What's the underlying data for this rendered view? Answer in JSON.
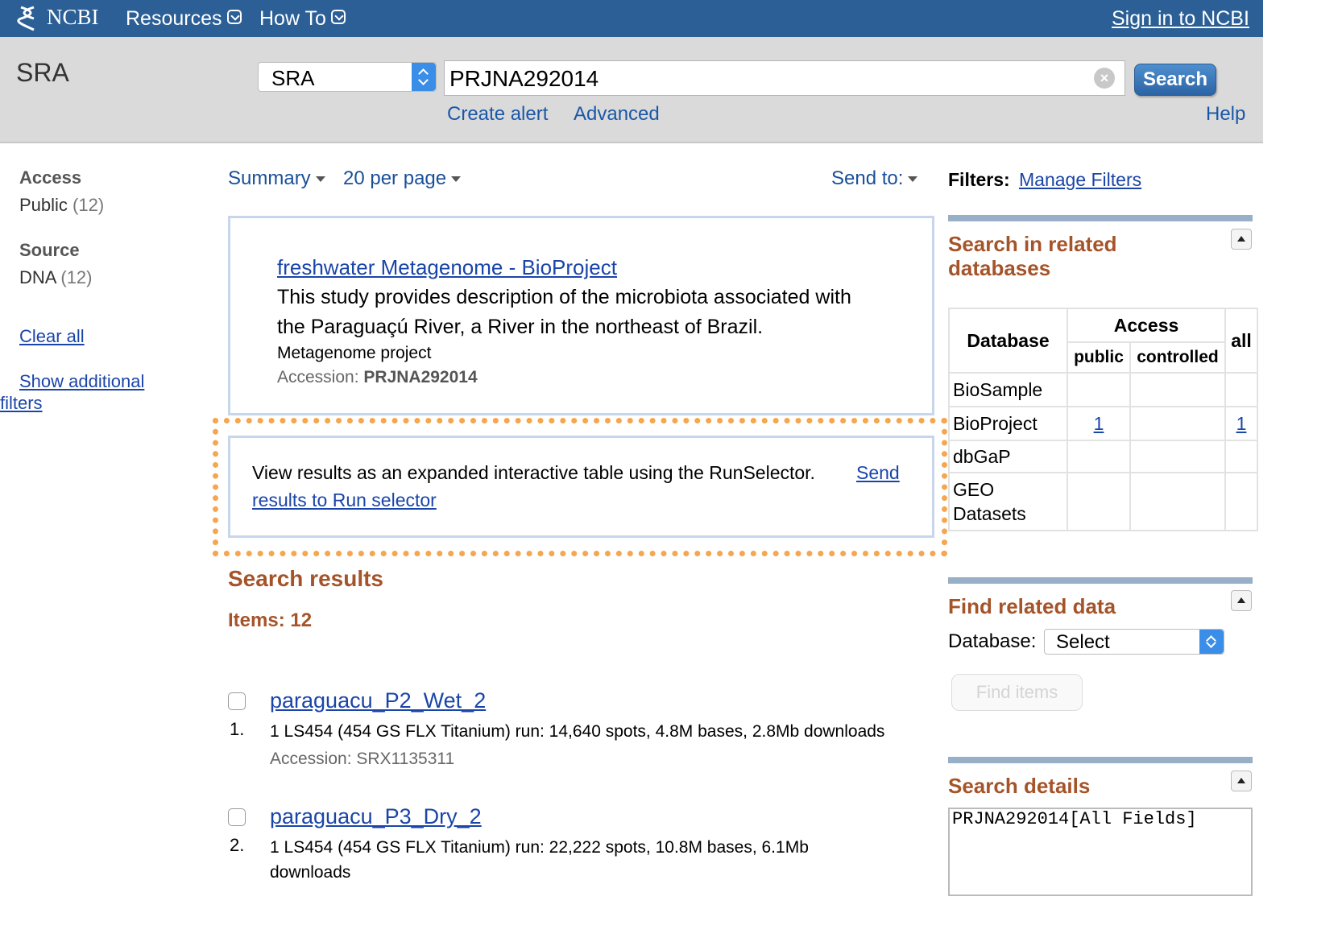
{
  "topbar": {
    "logo": "NCBI",
    "resources": "Resources",
    "how_to": "How To",
    "sign_in": "Sign in to NCBI"
  },
  "search": {
    "db_label": "SRA",
    "db_selected": "SRA",
    "term": "PRJNA292014",
    "search_button": "Search",
    "create_alert": "Create alert",
    "advanced": "Advanced",
    "help": "Help"
  },
  "filters": {
    "groups": [
      {
        "heading": "Access",
        "item": "Public",
        "count": "(12)"
      },
      {
        "heading": "Source",
        "item": "DNA",
        "count": "(12)"
      }
    ],
    "clear_all": "Clear all",
    "show_additional_1": "Show additional",
    "show_additional_2": "filters"
  },
  "display": {
    "format": "Summary",
    "per_page": "20 per page",
    "send_to": "Send to:"
  },
  "bioproject": {
    "title": "freshwater Metagenome - BioProject",
    "description_line1": "This study provides description of the microbiota associated with",
    "description_line2": "the Paraguaçú River, a River in the northeast of Brazil.",
    "project_type": "Metagenome project",
    "accession_label": "Accession:",
    "accession_value": "PRJNA292014"
  },
  "runselector": {
    "text": "View results as an expanded interactive table using the RunSelector.",
    "link_part1": "Send",
    "link_part2": "results to Run selector"
  },
  "results": {
    "heading": "Search results",
    "items_count": "Items: 12",
    "list": [
      {
        "num": "1.",
        "title": "paraguacu_P2_Wet_2",
        "desc": "1 LS454 (454 GS FLX Titanium) run: 14,640 spots, 4.8M bases, 2.8Mb downloads",
        "accession": "Accession: SRX1135311"
      },
      {
        "num": "2.",
        "title": "paraguacu_P3_Dry_2",
        "desc_line1": "1 LS454 (454 GS FLX Titanium) run: 22,222 spots, 10.8M bases, 6.1Mb",
        "desc_line2": "downloads"
      }
    ]
  },
  "right": {
    "filters_label": "Filters:",
    "manage_filters": "Manage Filters",
    "related_db_heading_1": "Search in related",
    "related_db_heading_2": "databases",
    "table": {
      "col_database": "Database",
      "col_access": "Access",
      "col_public": "public",
      "col_controlled": "controlled",
      "col_all": "all",
      "rows": [
        {
          "db": "BioSample",
          "public": "",
          "controlled": "",
          "all": ""
        },
        {
          "db": "BioProject",
          "public": "1",
          "controlled": "",
          "all": "1"
        },
        {
          "db": "dbGaP",
          "public": "",
          "controlled": "",
          "all": ""
        },
        {
          "db_line1": "GEO",
          "db_line2": "Datasets",
          "public": "",
          "controlled": "",
          "all": ""
        }
      ]
    },
    "find_related_heading": "Find related data",
    "database_label": "Database:",
    "database_selected": "Select",
    "find_items": "Find items",
    "search_details_heading": "Search details",
    "search_details_query": "PRJNA292014[All Fields]"
  },
  "colors": {
    "topbar": "#2b5f96",
    "link": "#1a45a8",
    "section_heading": "#a5542a",
    "highlight_dots": "#f5a64f"
  },
  "icons": [
    "ncbi-helix-icon",
    "chevron-down-icon",
    "clear-icon",
    "select-arrows-icon",
    "caret-down-icon",
    "collapse-up-icon"
  ]
}
